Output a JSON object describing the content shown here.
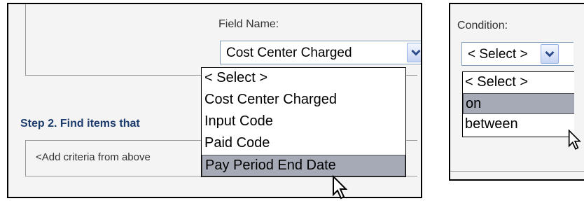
{
  "left_panel": {
    "field_label": "Field Name:",
    "field_select": {
      "selected": "Cost Center Charged"
    },
    "field_options": [
      "< Select >",
      "Cost Center Charged",
      "Input Code",
      "Paid Code",
      "Pay Period End Date"
    ],
    "highlighted_option": "Pay Period End Date",
    "step2_title": "Step 2. Find items that",
    "criteria_placeholder": "<Add criteria from above"
  },
  "right_panel": {
    "condition_label": "Condition:",
    "condition_select": {
      "selected": "< Select >"
    },
    "condition_options": [
      "< Select >",
      "on",
      "between"
    ],
    "highlighted_option": "on"
  },
  "icons": {
    "dropdown_arrow": "chevron-down-icon",
    "pointer": "mouse-pointer-icon"
  }
}
